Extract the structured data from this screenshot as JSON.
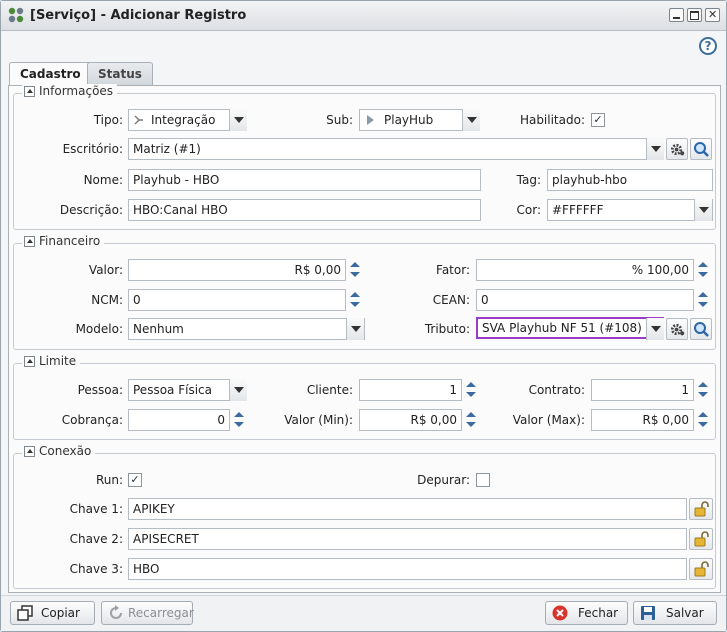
{
  "window": {
    "title": "[Serviço] - Adicionar Registro",
    "help_label": "?"
  },
  "tabs": [
    {
      "label": "Cadastro",
      "active": true
    },
    {
      "label": "Status",
      "active": false
    }
  ],
  "informacoes": {
    "legend": "Informações",
    "tipo_label": "Tipo:",
    "tipo_value": "Integração",
    "sub_label": "Sub:",
    "sub_value": "PlayHub",
    "habilitado_label": "Habilitado:",
    "habilitado_checked": "✓",
    "escritorio_label": "Escritório:",
    "escritorio_value": "Matriz (#1)",
    "nome_label": "Nome:",
    "nome_value": "Playhub - HBO",
    "tag_label": "Tag:",
    "tag_value": "playhub-hbo",
    "descricao_label": "Descrição:",
    "descricao_value": "HBO:Canal HBO",
    "cor_label": "Cor:",
    "cor_value": "#FFFFFF"
  },
  "financeiro": {
    "legend": "Financeiro",
    "valor_label": "Valor:",
    "valor_value": "R$ 0,00",
    "fator_label": "Fator:",
    "fator_value": "% 100,00",
    "ncm_label": "NCM:",
    "ncm_value": "0",
    "cean_label": "CEAN:",
    "cean_value": "0",
    "modelo_label": "Modelo:",
    "modelo_value": "Nenhum",
    "tributo_label": "Tributo:",
    "tributo_value": "SVA Playhub NF 51 (#108)"
  },
  "limite": {
    "legend": "Limite",
    "pessoa_label": "Pessoa:",
    "pessoa_value": "Pessoa Física",
    "cliente_label": "Cliente:",
    "cliente_value": "1",
    "contrato_label": "Contrato:",
    "contrato_value": "1",
    "cobranca_label": "Cobrança:",
    "cobranca_value": "0",
    "valor_min_label": "Valor (Min):",
    "valor_min_value": "R$ 0,00",
    "valor_max_label": "Valor (Max):",
    "valor_max_value": "R$ 0,00"
  },
  "conexao": {
    "legend": "Conexão",
    "run_label": "Run:",
    "run_checked": "✓",
    "depurar_label": "Depurar:",
    "chave1_label": "Chave 1:",
    "chave1_value": "APIKEY",
    "chave2_label": "Chave 2:",
    "chave2_value": "APISECRET",
    "chave3_label": "Chave 3:",
    "chave3_value": "HBO"
  },
  "footer": {
    "copiar": "Copiar",
    "recarregar": "Recarregar",
    "fechar": "Fechar",
    "salvar": "Salvar"
  },
  "colors": {
    "accent": "#3a6aa0",
    "focus_border": "#9b3bc9",
    "close_red": "#d9342b"
  }
}
